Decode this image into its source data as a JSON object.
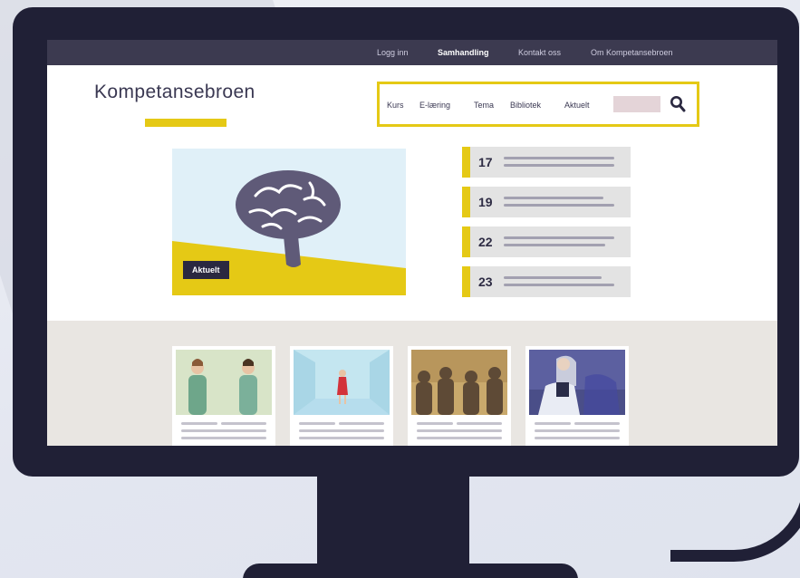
{
  "topbar": {
    "links": [
      {
        "label": "Logg inn",
        "active": false
      },
      {
        "label": "Samhandling",
        "active": true
      },
      {
        "label": "Kontakt oss",
        "active": false
      },
      {
        "label": "Om Kompetansebroen",
        "active": false
      }
    ]
  },
  "logo": {
    "text": "Kompetansebroen"
  },
  "nav": {
    "items": [
      "Kurs",
      "E-læring",
      "Tema",
      "Bibliotek",
      "Aktuelt"
    ],
    "search_icon": "search-icon"
  },
  "hero": {
    "badge": "Aktuelt",
    "image": "brain-illustration"
  },
  "events": [
    {
      "day": "17"
    },
    {
      "day": "19"
    },
    {
      "day": "22"
    },
    {
      "day": "23"
    }
  ],
  "cards": [
    {
      "image": "two-people-illustration"
    },
    {
      "image": "girl-in-room-illustration"
    },
    {
      "image": "audience-silhouettes-illustration"
    },
    {
      "image": "elderly-person-illustration"
    }
  ],
  "colors": {
    "accent": "#e5c915",
    "dark": "#202036",
    "topbar": "#3c3a50"
  }
}
